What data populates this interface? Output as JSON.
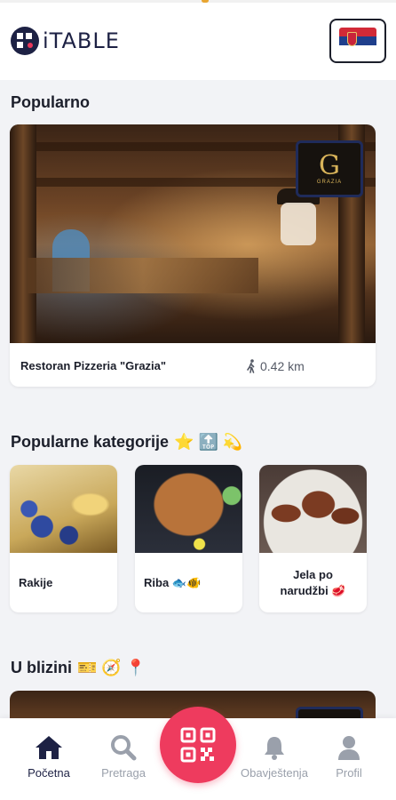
{
  "app": {
    "logo_text": "iTABLE",
    "language_flag": "serbia-flag-icon"
  },
  "sections": {
    "popular": {
      "title": "Popularno"
    },
    "categories": {
      "title": "Popularne kategorije",
      "emoji": "⭐ 🔝 💫"
    },
    "nearby": {
      "title": "U blizini",
      "emoji": "🎫 🧭 📍"
    }
  },
  "featured": {
    "name": "Restoran Pizzeria \"Grazia\"",
    "distance": "0.42 km",
    "logo_letter": "G",
    "logo_sub": "GRAZIA"
  },
  "categories": [
    {
      "label": "Rakije"
    },
    {
      "label": "Riba 🐟🐠"
    },
    {
      "label_line1": "Jela po",
      "label_line2": "narudžbi 🥩"
    }
  ],
  "bottom_nav": {
    "home": "Početna",
    "search": "Pretraga",
    "notifications": "Obavještenja",
    "profile": "Profil"
  },
  "colors": {
    "accent": "#ee3b5e",
    "navy": "#1d2144",
    "inactive": "#9aa0ab"
  }
}
